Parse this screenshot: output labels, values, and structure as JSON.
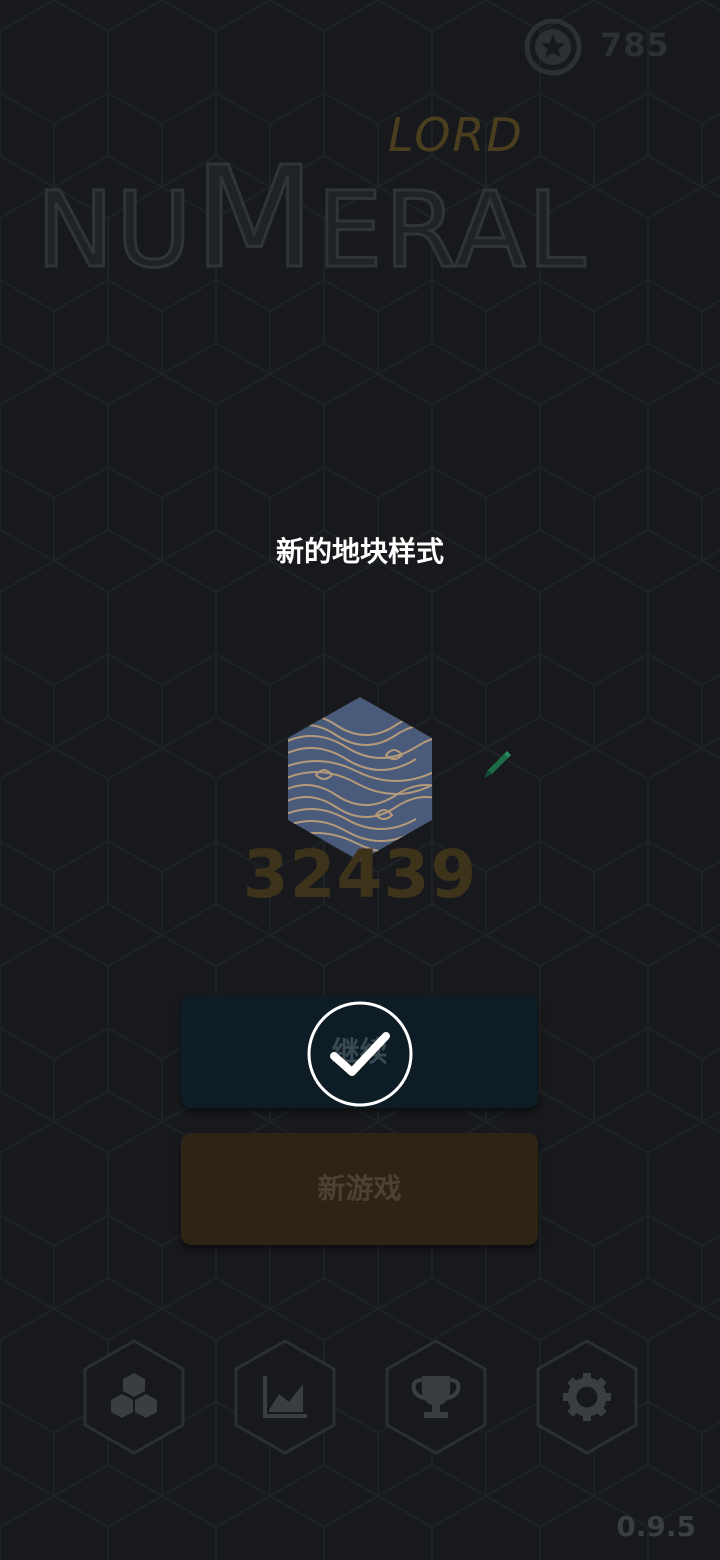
{
  "header": {
    "coin_count": "785",
    "coin_icon": "star-coin-icon"
  },
  "logo": {
    "small": "LORD",
    "main": "NUMERAL"
  },
  "popup": {
    "title": "新的地块样式",
    "tile_pattern": "wave-pattern",
    "score": "32439"
  },
  "menu": {
    "continue_label": "继续",
    "new_game_label": "新游戏"
  },
  "nav": {
    "items": [
      "tiles-icon",
      "stats-icon",
      "trophy-icon",
      "gear-icon"
    ]
  },
  "footer": {
    "version": "0.9.5"
  },
  "colors": {
    "background": "#17191c",
    "hex_grid": "#1e2124",
    "gold": "#4a3e1f",
    "continue_bg": "#0e1d25",
    "new_game_bg": "#2e2416"
  }
}
